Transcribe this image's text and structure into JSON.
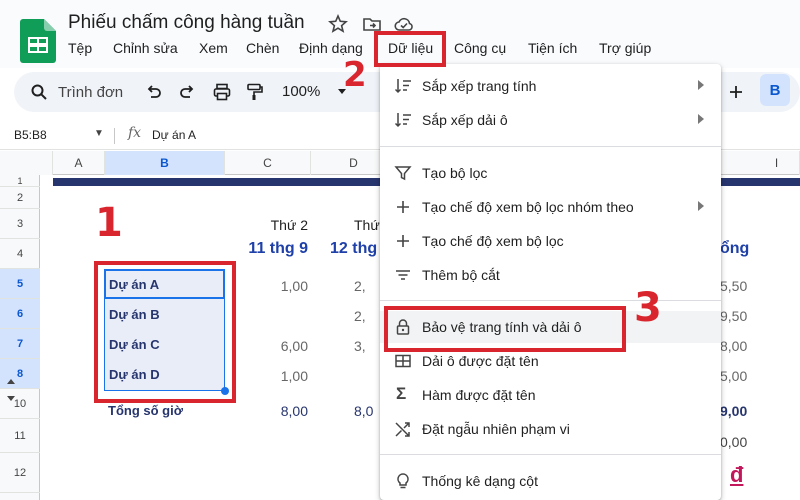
{
  "app": {
    "title": "Phiếu chấm công hàng tuần",
    "menu": [
      "Tệp",
      "Chỉnh sửa",
      "Xem",
      "Chèn",
      "Định dạng",
      "Dữ liệu",
      "Công cụ",
      "Tiện ích",
      "Trợ giúp"
    ]
  },
  "toolbar": {
    "search_label": "Trình đơn",
    "zoom": "100%",
    "bold_label": "B"
  },
  "formula_bar": {
    "name_box": "B5:B8",
    "fx": "fx",
    "value": "Dự án A"
  },
  "columns": [
    "A",
    "B",
    "C",
    "D",
    "I"
  ],
  "rows": [
    "1",
    "2",
    "3",
    "4",
    "5",
    "6",
    "7",
    "8",
    "10",
    "11",
    "12"
  ],
  "sheet": {
    "c_day": "Thứ 2",
    "c_date": "11 thg 9",
    "d_day": "Thứ",
    "d_date": "12 thg",
    "right_header": "ổng",
    "projects": [
      "Dự án A",
      "Dự án B",
      "Dự án C",
      "Dự án D"
    ],
    "c_values": [
      "1,00",
      "",
      "6,00",
      "1,00"
    ],
    "d_values": [
      "2,",
      "2,",
      "3,",
      ""
    ],
    "right_values": [
      "5,50",
      "9,50",
      "8,00",
      "5,00"
    ],
    "total_label": "Tổng số giờ",
    "total_c": "8,00",
    "total_d": "8,0",
    "total_right": "9,00",
    "row11_right": "0,00",
    "row12_right": "đ"
  },
  "annotations": [
    "1",
    "2",
    "3"
  ],
  "menu_dropdown": {
    "items": [
      {
        "label": "Sắp xếp trang tính",
        "icon": "sort-icon",
        "submenu": true
      },
      {
        "label": "Sắp xếp dải ô",
        "icon": "sort-range-icon",
        "submenu": true
      },
      {
        "label": "Tạo bộ lọc",
        "icon": "filter-icon",
        "submenu": false
      },
      {
        "label": "Tạo chế độ xem bộ lọc nhóm theo",
        "icon": "plus-icon",
        "submenu": true
      },
      {
        "label": "Tạo chế độ xem bộ lọc",
        "icon": "plus-icon",
        "submenu": false
      },
      {
        "label": "Thêm bộ cắt",
        "icon": "slicer-icon",
        "submenu": false
      },
      {
        "label": "Bảo vệ trang tính và dải ô",
        "icon": "lock-icon",
        "submenu": false
      },
      {
        "label": "Dải ô được đặt tên",
        "icon": "table-icon",
        "submenu": false
      },
      {
        "label": "Hàm được đặt tên",
        "icon": "sigma-icon",
        "submenu": false
      },
      {
        "label": "Đặt ngẫu nhiên phạm vi",
        "icon": "shuffle-icon",
        "submenu": false
      },
      {
        "label": "Thống kê dạng cột",
        "icon": "lightbulb-icon",
        "submenu": false
      }
    ]
  },
  "colors": {
    "accent": "#1a73e8",
    "annotation_red": "#d9262e",
    "header_navy": "#27356e",
    "sheets_green": "#0f9d58"
  }
}
